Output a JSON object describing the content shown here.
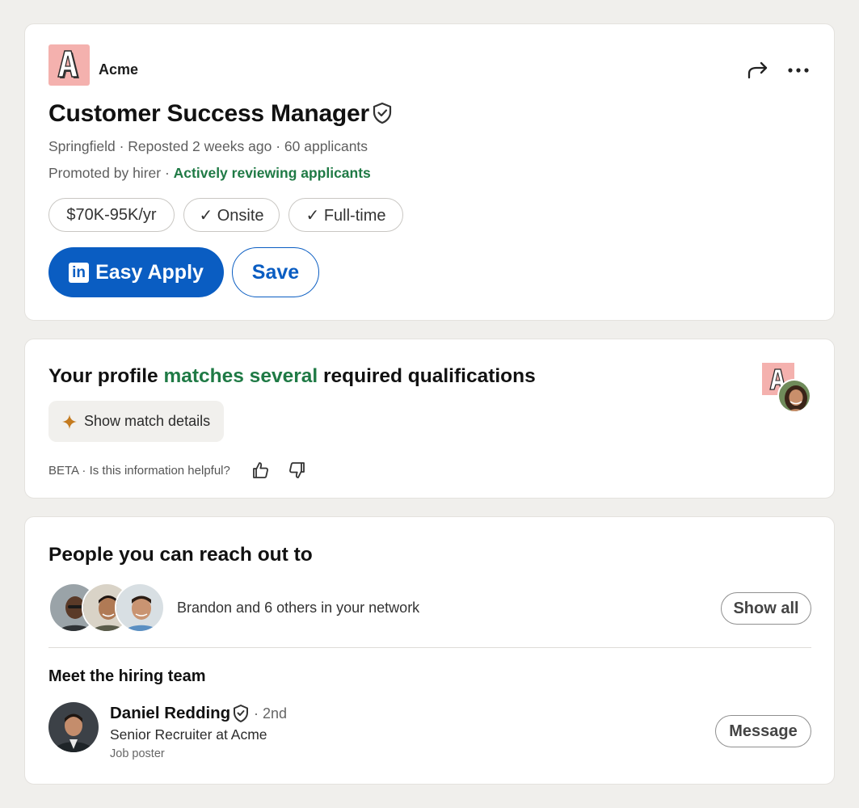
{
  "job": {
    "company": "Acme",
    "title": "Customer Success Manager",
    "location": "Springfield",
    "posted": "Reposted 2 weeks ago",
    "applicants": "60 applicants",
    "promoted": "Promoted by hirer",
    "status": "Actively reviewing applicants",
    "pills": [
      "$70K-95K/yr",
      "✓ Onsite",
      "✓ Full-time"
    ],
    "apply_label": "Easy Apply",
    "apply_logo": "in",
    "save_label": "Save",
    "icons": [
      "share-icon",
      "more-icon",
      "verified-icon"
    ]
  },
  "match": {
    "title_pre": "Your profile ",
    "title_highlight": "matches several",
    "title_post": " required qualifications",
    "details_label": "Show match details",
    "beta": "BETA",
    "helpful_question": "Is this information helpful?"
  },
  "people": {
    "title": "People you can reach out to",
    "network_text": "Brandon and 6 others in your network",
    "show_all_label": "Show all",
    "hiring_title": "Meet the hiring team",
    "recruiter": {
      "name": "Daniel Redding",
      "degree": "2nd",
      "role": "Senior Recruiter at Acme",
      "tag": "Job poster",
      "message_label": "Message"
    }
  },
  "colors": {
    "accent_blue": "#0a5dc2",
    "accent_green": "#1f7a45",
    "logo_pink": "#f4b1ae",
    "page_bg": "#f0efec"
  }
}
